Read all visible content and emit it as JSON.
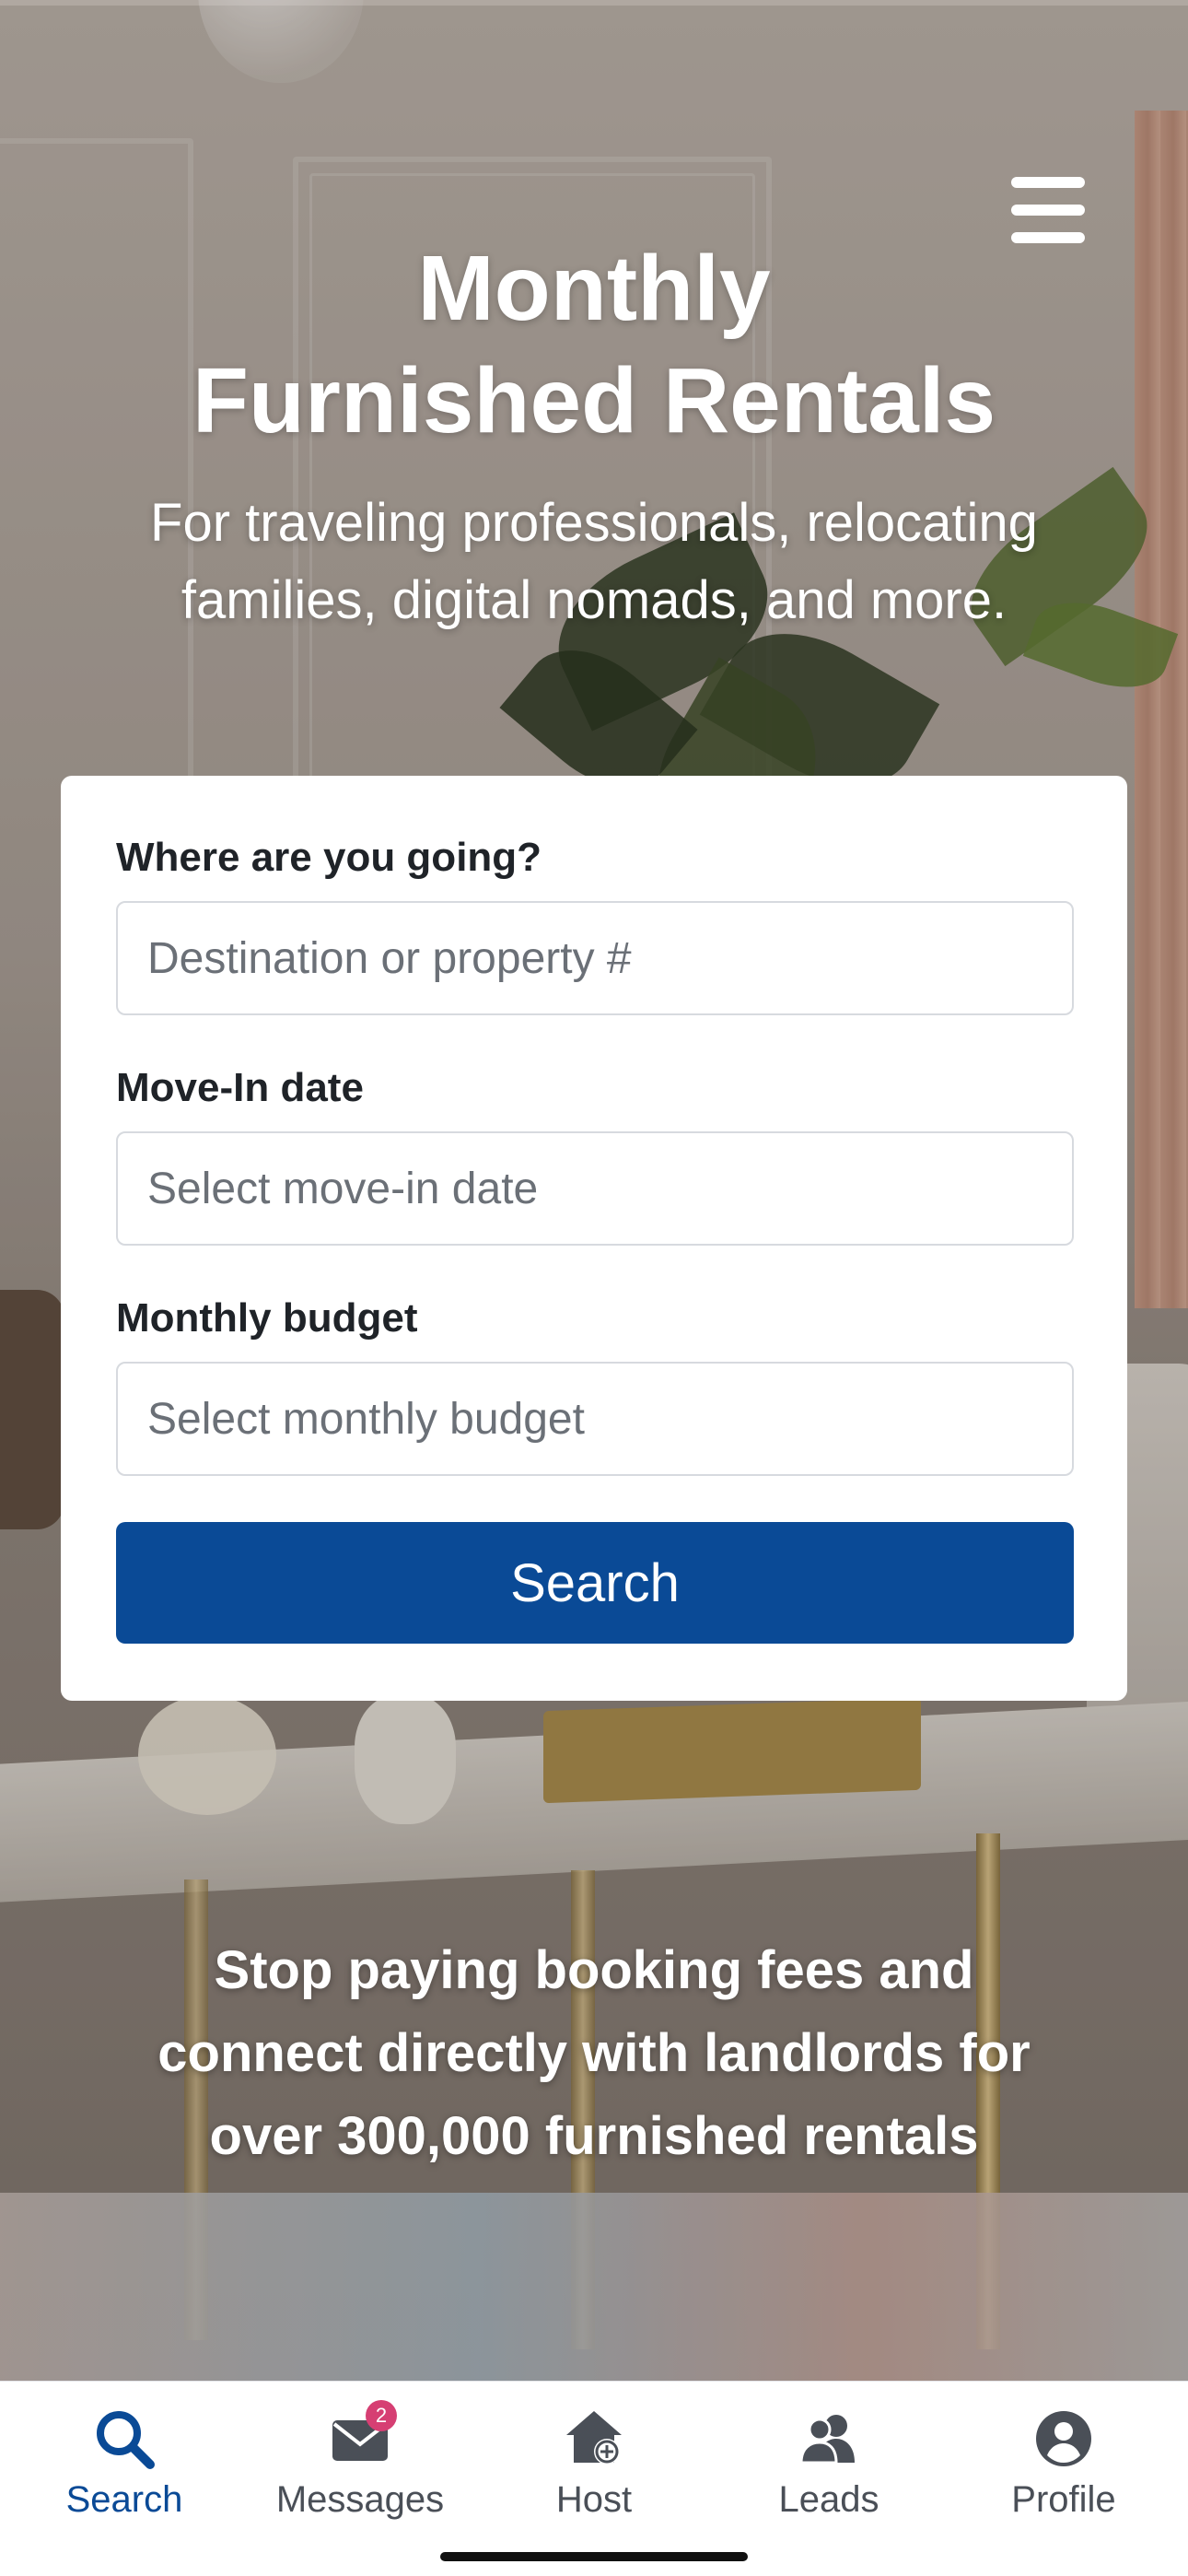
{
  "hero": {
    "title_line1": "Monthly",
    "title_line2": "Furnished Rentals",
    "subtitle_line1": "For traveling professionals, relocating",
    "subtitle_line2": "families, digital nomads, and more."
  },
  "menu": {
    "icon": "hamburger-menu-icon"
  },
  "search_form": {
    "destination": {
      "label": "Where are you going?",
      "placeholder": "Destination or property #",
      "value": ""
    },
    "move_in": {
      "label": "Move-In date",
      "placeholder": "Select move-in date",
      "value": ""
    },
    "budget": {
      "label": "Monthly budget",
      "placeholder": "Select monthly budget",
      "value": ""
    },
    "submit_label": "Search"
  },
  "promo": {
    "line1": "Stop paying booking fees and",
    "line2": "connect directly with landlords for",
    "line3": "over 300,000 furnished rentals"
  },
  "tabbar": {
    "tabs": [
      {
        "label": "Search",
        "icon": "search-icon",
        "active": true
      },
      {
        "label": "Messages",
        "icon": "envelope-icon",
        "badge": "2"
      },
      {
        "label": "Host",
        "icon": "home-add-icon"
      },
      {
        "label": "Leads",
        "icon": "people-icon"
      },
      {
        "label": "Profile",
        "icon": "user-circle-icon"
      }
    ]
  },
  "colors": {
    "brand_blue": "#0a4a96",
    "badge_pink": "#d63f73",
    "tab_inactive": "#4a4f57"
  }
}
